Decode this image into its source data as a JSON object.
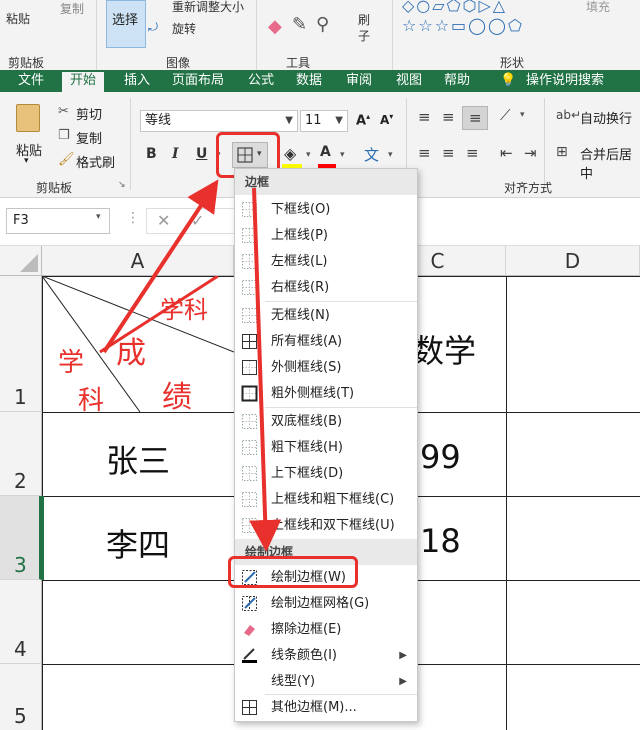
{
  "top_strip": {
    "paste": "粘贴",
    "copy": "复制",
    "select": "选择",
    "resize": "重新调整大小",
    "rotate": "旋转",
    "brush": "刷子",
    "fill": "填充",
    "groups": [
      "剪贴板",
      "图像",
      "工具",
      "形状"
    ]
  },
  "tabs": [
    "文件",
    "开始",
    "插入",
    "页面布局",
    "公式",
    "数据",
    "审阅",
    "视图",
    "帮助",
    "操作说明搜索"
  ],
  "ribbon": {
    "paste": "粘贴",
    "cut": "剪切",
    "copy": "复制",
    "format_painter": "格式刷",
    "clipboard_group": "剪贴板",
    "font_name": "等线",
    "font_size": "11",
    "bold": "B",
    "italic": "I",
    "underline": "U",
    "font_color_letter": "A",
    "wrap_text": "自动换行",
    "merge_center": "合并后居中",
    "alignment_group": "对齐方式"
  },
  "formula_bar": {
    "name_box": "F3"
  },
  "columns": [
    "A",
    "C",
    "D"
  ],
  "rows": [
    "1",
    "2",
    "3",
    "4",
    "5"
  ],
  "cells": {
    "a1_top_right": "学科",
    "a1_mid": "成",
    "a1_left": "学",
    "a1_left2": "科",
    "a1_bottom": "绩",
    "c1": "数学",
    "a2": "张三",
    "c2": "99",
    "a3": "李四",
    "c3": "18"
  },
  "menu": {
    "section_borders": "边框",
    "section_draw": "绘制边框",
    "items": [
      "下框线(O)",
      "上框线(P)",
      "左框线(L)",
      "右框线(R)",
      "无框线(N)",
      "所有框线(A)",
      "外侧框线(S)",
      "粗外侧框线(T)",
      "双底框线(B)",
      "粗下框线(H)",
      "上下框线(D)",
      "上框线和粗下框线(C)",
      "上框线和双下框线(U)"
    ],
    "draw_items": [
      "绘制边框(W)",
      "绘制边框网格(G)",
      "擦除边框(E)",
      "线条颜色(I)",
      "线型(Y)",
      "其他边框(M)..."
    ]
  },
  "colors": {
    "excel_green": "#217346",
    "highlight_red": "#e8302c"
  }
}
